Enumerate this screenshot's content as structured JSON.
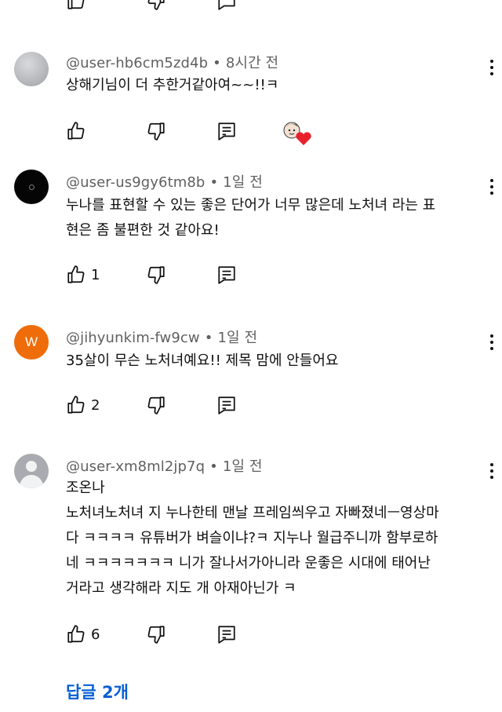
{
  "comments": [
    {
      "handle": "@user-hb6cm5zd4b",
      "time": "8시간 전",
      "lines": [
        "상해기님이 더 추한거같아여~~!!ㅋ"
      ],
      "likes": "",
      "creator_heart": true
    },
    {
      "handle": "@user-us9gy6tm8b",
      "time": "1일 전",
      "lines": [
        "누나를 표현할 수 있는 좋은 단어가 너무 많은데 노처녀 라는 표",
        "현은 좀 불편한 것 같아요!"
      ],
      "likes": "1"
    },
    {
      "handle": "@jihyunkim-fw9cw",
      "time": "1일 전",
      "avatar_letter": "W",
      "lines": [
        "35살이 무슨 노처녀예요!! 제목 맘에 안들어요"
      ],
      "likes": "2"
    },
    {
      "handle": "@user-xm8ml2jp7q",
      "time": "1일 전",
      "lines": [
        "조온나",
        "노처녀노처녀 지 누나한테 맨날 프레임씌우고 자빠졌네ㅡ영상마",
        "다 ㅋㅋㅋㅋ 유튜버가 벼슬이냐?ㅋ 지누나 월급주니까 함부로하",
        "네 ㅋㅋㅋㅋㅋㅋㅋ 니가 잘나서가아니라 운좋은 시대에 태어난",
        "거라고 생각해라 지도 개 아재아닌가 ㅋ"
      ],
      "likes": "6"
    }
  ],
  "replies_label": "답글 2개",
  "colors": {
    "link": "#065fd4",
    "meta": "#606060",
    "text": "#0f0f0f"
  }
}
